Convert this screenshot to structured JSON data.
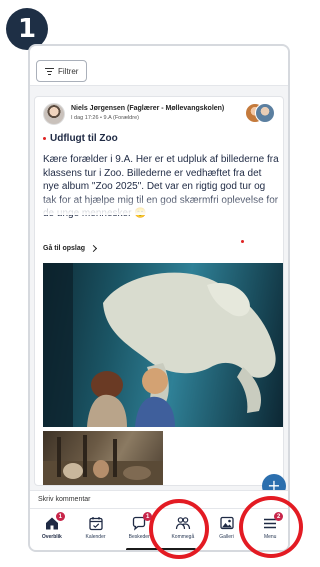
{
  "step": {
    "number": "1"
  },
  "filter": {
    "label": "Filtrer"
  },
  "post": {
    "author": "Niels Jørgensen (Faglærer - Møllevangskolen)",
    "meta": "I dag 17:26 • 9.A (Forældre)",
    "title": "Udflugt til Zoo",
    "body": "Kære forælder i 9.A. Her er et udpluk af billederne fra klassens tur i Zoo. Billederne er vedhæftet fra det nye album \"Zoo 2025\". Det var en rigtig god tur og tak for at hjælpe mig til en god skærmfri oplevelse for de unge mennesker 😊",
    "read_more": "Gå til opslag"
  },
  "comment": {
    "label": "Skriv kommentar"
  },
  "nav": {
    "items": [
      {
        "label": "Overblik",
        "badge": "1",
        "active": true
      },
      {
        "label": "Kalender"
      },
      {
        "label": "Beskeder",
        "badge": "1"
      },
      {
        "label": "Kommegå"
      },
      {
        "label": "Galleri"
      },
      {
        "label": "Menu",
        "badge": "2"
      }
    ]
  },
  "colors": {
    "accent": "#2c6fae",
    "badge": "#c8264a",
    "highlight": "#e31b23",
    "step_badge": "#1e2f45"
  }
}
